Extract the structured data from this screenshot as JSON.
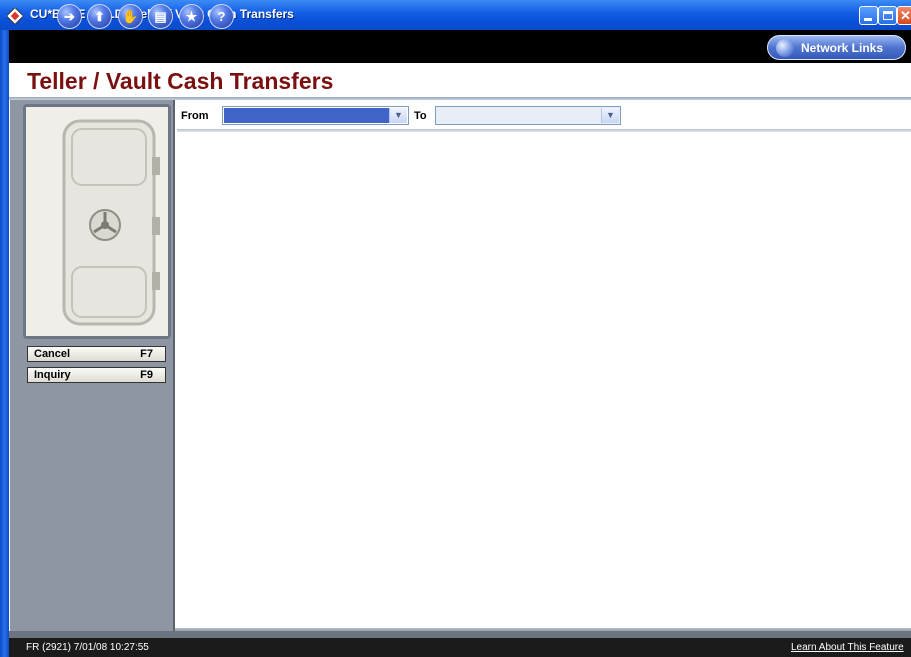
{
  "window": {
    "title": "CU*BASE GOLD - Teller / Vault Cash Transfers",
    "colors": {
      "titlebar": "#0b4cc9",
      "page_title": "#7b1010",
      "panel": "#8e96a3"
    }
  },
  "toolbar": {
    "icons": [
      {
        "name": "forward-arrow-icon",
        "glyph": "➔"
      },
      {
        "name": "up-arrow-icon",
        "glyph": "⬆"
      },
      {
        "name": "hand-icon",
        "glyph": "✋"
      },
      {
        "name": "print-icon",
        "glyph": "▤"
      },
      {
        "name": "star-icon",
        "glyph": "★"
      },
      {
        "name": "help-icon",
        "glyph": "?"
      }
    ],
    "network_links_label": "Network Links"
  },
  "page": {
    "title": "Teller / Vault Cash Transfers"
  },
  "filters": {
    "from_label": "From",
    "to_label": "To",
    "from_value": "",
    "to_value": ""
  },
  "left_panel": {
    "buttons": [
      {
        "label": "Cancel",
        "key": "F7"
      },
      {
        "label": "Inquiry",
        "key": "F9"
      }
    ]
  },
  "status": {
    "left": "FR (2921) 7/01/08 10:27:55",
    "right": "Learn About This Feature"
  }
}
